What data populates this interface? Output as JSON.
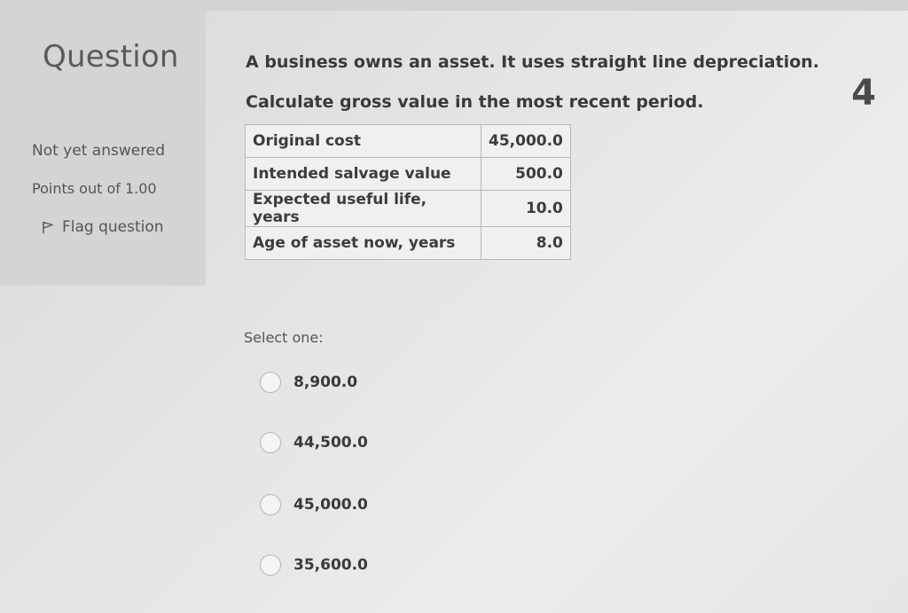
{
  "question": {
    "label": "Question",
    "number": "4",
    "status": "Not yet answered",
    "points": "Points out of 1.00",
    "flag_label": "Flag question",
    "text_line1": "A business owns an asset. It uses straight line depreciation.",
    "text_line2": "Calculate gross value in the most recent period."
  },
  "table": {
    "rows": [
      {
        "label": "Original cost",
        "value": "45,000.0"
      },
      {
        "label": "Intended salvage value",
        "value": "500.0"
      },
      {
        "label": "Expected useful life, years",
        "value": "10.0"
      },
      {
        "label": "Age of asset now, years",
        "value": "8.0"
      }
    ]
  },
  "answer": {
    "prompt": "Select one:",
    "options": [
      "8,900.0",
      "44,500.0",
      "45,000.0",
      "35,600.0"
    ]
  },
  "colors": {
    "panel_bg": "#d4d4d2",
    "text": "#3a3a3a",
    "muted": "#555555"
  },
  "icons": {
    "flag": "flag-icon",
    "radio": "radio-button"
  }
}
